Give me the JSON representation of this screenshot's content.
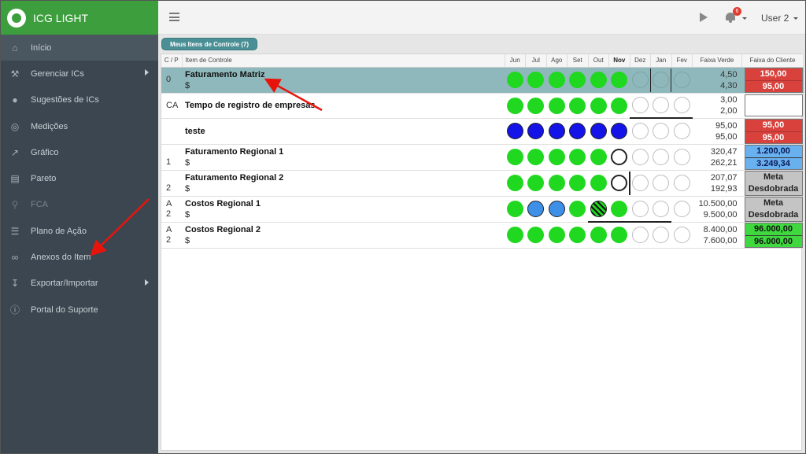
{
  "app": {
    "title": "ICG LIGHT"
  },
  "sidebar": {
    "items": [
      {
        "label": "Início",
        "icon": "home-icon"
      },
      {
        "label": "Gerenciar ICs",
        "icon": "wrench-icon",
        "submenu": true
      },
      {
        "label": "Sugestões de ICs",
        "icon": "lightbulb-icon"
      },
      {
        "label": "Medições",
        "icon": "target-icon"
      },
      {
        "label": "Gráfico",
        "icon": "line-chart-icon"
      },
      {
        "label": "Pareto",
        "icon": "bar-chart-icon"
      },
      {
        "label": "FCA",
        "icon": "search-icon",
        "disabled": true
      },
      {
        "label": "Plano de Ação",
        "icon": "list-icon"
      },
      {
        "label": "Anexos do Item",
        "icon": "paperclip-icon"
      },
      {
        "label": "Exportar/Importar",
        "icon": "download-icon",
        "submenu": true
      },
      {
        "label": "Portal do Suporte",
        "icon": "info-icon"
      }
    ]
  },
  "topbar": {
    "notifications": "6",
    "user": "User 2"
  },
  "tab": {
    "label": "Meus Itens de Controle (7)"
  },
  "table": {
    "headers": {
      "cp": "C / P",
      "item": "Item de Controle",
      "verde": "Faixa Verde",
      "cliente": "Faixa do Cliente"
    },
    "months": [
      "Jun",
      "Jul",
      "Ago",
      "Set",
      "Out",
      "Nov",
      "Dez",
      "Jan",
      "Fev"
    ],
    "rows": [
      {
        "cp1": "",
        "cp2": "0",
        "name": "Faturamento Matriz",
        "unit": "$",
        "v1": "4,50",
        "v2": "4,30",
        "c1": "150,00",
        "c2": "95,00"
      },
      {
        "cp1": "CA",
        "cp2": "",
        "name": "Tempo de registro de empresas",
        "unit": "",
        "v1": "3,00",
        "v2": "2,00",
        "c1": "",
        "c2": ""
      },
      {
        "cp1": "",
        "cp2": "",
        "name": "teste",
        "unit": "",
        "v1": "95,00",
        "v2": "95,00",
        "c1": "95,00",
        "c2": "95,00"
      },
      {
        "cp1": "",
        "cp2": "1",
        "name": "Faturamento Regional 1",
        "unit": "$",
        "v1": "320,47",
        "v2": "262,21",
        "c1": "1.200,00",
        "c2": "3.249,34"
      },
      {
        "cp1": "",
        "cp2": "2",
        "name": "Faturamento Regional 2",
        "unit": "$",
        "v1": "207,07",
        "v2": "192,93",
        "c1": "Meta",
        "c2": "Desdobrada"
      },
      {
        "cp1": "A",
        "cp2": "2",
        "name": "Costos Regional 1",
        "unit": "$",
        "v1": "10.500,00",
        "v2": "9.500,00",
        "c1": "Meta",
        "c2": "Desdobrada"
      },
      {
        "cp1": "A",
        "cp2": "2",
        "name": "Costos Regional 2",
        "unit": "$",
        "v1": "8.400,00",
        "v2": "7.600,00",
        "c1": "96.000,00",
        "c2": "96.000,00"
      }
    ]
  }
}
